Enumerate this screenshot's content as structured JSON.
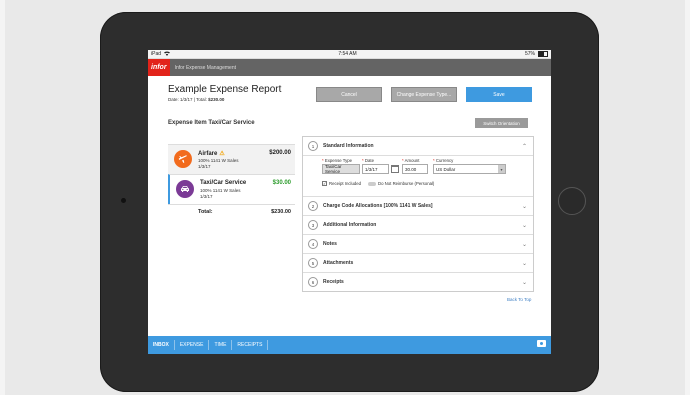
{
  "status": {
    "device": "iPad",
    "wifi_icon": "wifi-icon",
    "time": "7:54 AM",
    "battery": "57%"
  },
  "app": {
    "logo": "infor",
    "title": "Infor Expense Management"
  },
  "report": {
    "title": "Example Expense Report",
    "date_label": "Date: 1/3/17",
    "separator": "|",
    "total_label": "Total:",
    "total_value": "$230.00"
  },
  "actions": {
    "cancel": "Cancel",
    "change_type": "Change Expense Type...",
    "save": "Save"
  },
  "section": {
    "title": "Expense Item Taxi/Car Service",
    "switch_orientation": "Switch Orientation"
  },
  "items": [
    {
      "name": "Airfare",
      "warn": "⚠",
      "allocation": "100% 1141 W Sales",
      "date": "1/3/17",
      "amount": "$200.00",
      "icon": "airplane-icon",
      "color": "#f26b1d"
    },
    {
      "name": "Taxi/Car Service",
      "allocation": "100% 1141 W Sales",
      "date": "1/3/17",
      "amount": "$30.00",
      "icon": "car-icon",
      "color": "#7b3a96"
    }
  ],
  "total": {
    "label": "Total:",
    "value": "$230.00"
  },
  "accordion": [
    {
      "num": "1",
      "label": "Standard Information",
      "chevron": "⌃"
    },
    {
      "num": "2",
      "label": "Charge Code Allocations [100% 1141 W Sales]",
      "chevron": "⌄"
    },
    {
      "num": "3",
      "label": "Additional Information",
      "chevron": "⌄"
    },
    {
      "num": "4",
      "label": "Notes",
      "chevron": "⌄"
    },
    {
      "num": "5",
      "label": "Attachments",
      "chevron": "⌄"
    },
    {
      "num": "6",
      "label": "Receipts",
      "chevron": "⌄"
    }
  ],
  "form": {
    "expense_type_label": "Expense Type",
    "expense_type_value": "Taxi/Car Service",
    "date_label": "Date",
    "date_value": "1/3/17",
    "amount_label": "Amount",
    "amount_value": "30.00",
    "currency_label": "Currency",
    "currency_value": "US Dollar",
    "receipt_included": "Receipt Included",
    "do_not_reimburse": "Do Not Reimburse (Personal)"
  },
  "back_to_top": "Back To Top",
  "tabs": [
    "INBOX",
    "EXPENSE",
    "TIME",
    "RECEIPTS"
  ]
}
